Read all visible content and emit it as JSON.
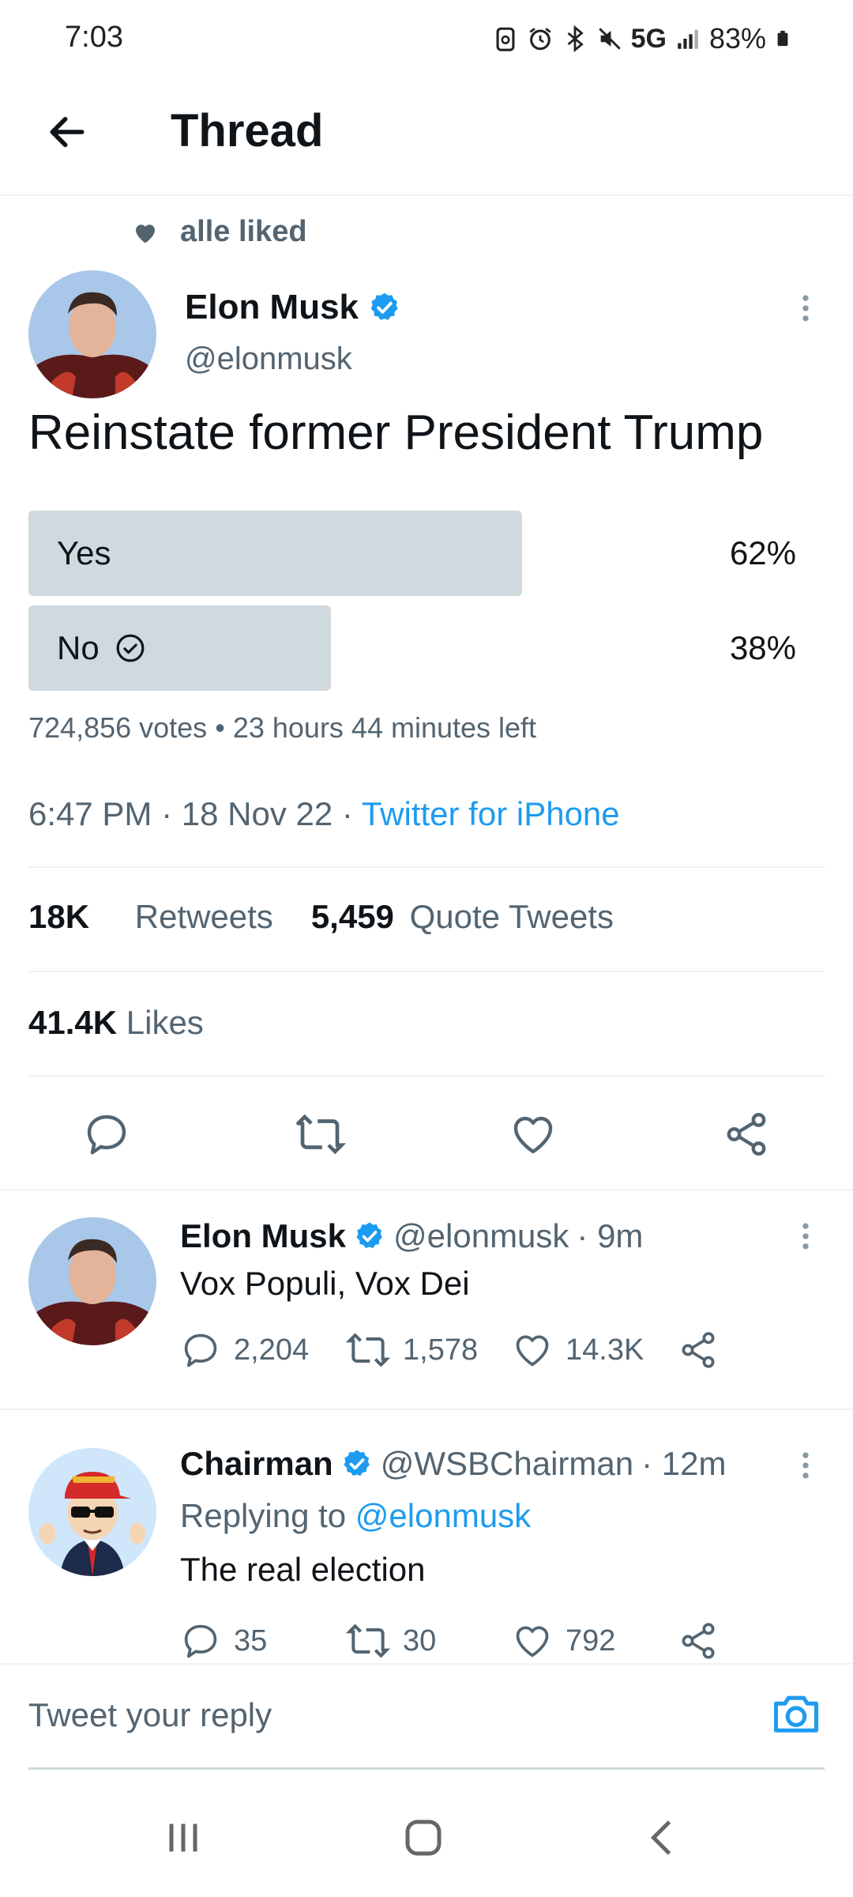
{
  "status": {
    "time": "7:03",
    "network": "5G",
    "battery": "83%"
  },
  "header": {
    "title": "Thread"
  },
  "social_context": {
    "text": "alle liked"
  },
  "tweet": {
    "author_name": "Elon Musk",
    "author_handle": "@elonmusk",
    "text": "Reinstate former President Trump",
    "poll": {
      "options": [
        {
          "label": "Yes",
          "percent_text": "62%",
          "fraction": 0.62
        },
        {
          "label": "No",
          "percent_text": "38%",
          "fraction": 0.38,
          "voted": true
        }
      ],
      "votes": "724,856 votes",
      "separator": "•",
      "time_left": "23 hours 44 minutes left"
    },
    "time": "6:47 PM",
    "date": "18 Nov 22",
    "dot": "·",
    "source": "Twitter for iPhone",
    "retweets_count": "18K",
    "retweets_label": "Retweets",
    "quotes_count": "5,459",
    "quotes_label": "Quote Tweets",
    "likes_count": "41.4K",
    "likes_label": "Likes"
  },
  "replies": [
    {
      "name": "Elon Musk",
      "handle": "@elonmusk",
      "age": "· 9m",
      "text": "Vox Populi, Vox Dei",
      "replies": "2,204",
      "retweets": "1,578",
      "likes": "14.3K"
    },
    {
      "name": "Chairman",
      "handle": "@WSBChairman",
      "age": "· 12m",
      "replying_prefix": "Replying to",
      "replying_to": "@elonmusk",
      "text": "The real election",
      "replies": "35",
      "retweets": "30",
      "likes": "792"
    }
  ],
  "compose": {
    "placeholder": "Tweet your reply"
  },
  "colors": {
    "accent": "#1d9bf0",
    "poll_fill": "#cfd9de",
    "muted": "#536471"
  }
}
